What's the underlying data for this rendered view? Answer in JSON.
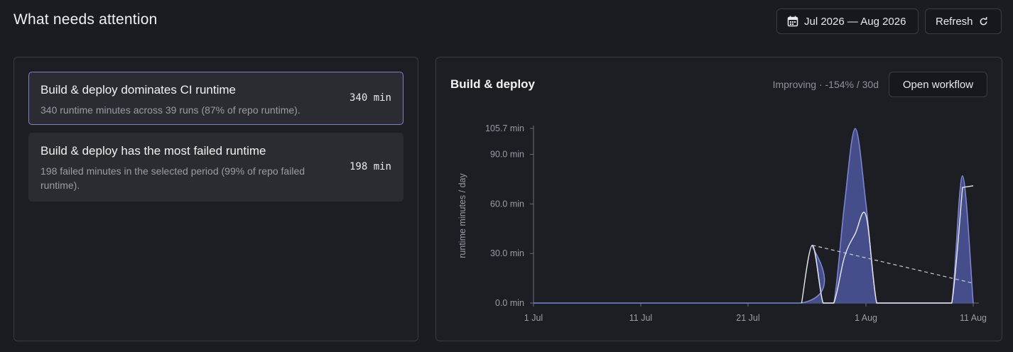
{
  "header": {
    "title": "What needs attention",
    "date_range": "Jul 2026 — Aug 2026",
    "refresh_label": "Refresh"
  },
  "insights": [
    {
      "title": "Build & deploy dominates CI runtime",
      "description": "340 runtime minutes across 39 runs (87% of repo runtime).",
      "metric": "340 min",
      "selected": true
    },
    {
      "title": "Build & deploy has the most failed runtime",
      "description": "198 failed minutes in the selected period (99% of repo failed runtime).",
      "metric": "198 min",
      "selected": false
    }
  ],
  "chart_panel": {
    "title": "Build & deploy",
    "trend": "Improving · -154% / 30d",
    "open_label": "Open workflow"
  },
  "colors": {
    "accent_fill": "#4a5296",
    "accent_line": "#7f88d6",
    "selected_border": "#7d82c8"
  },
  "chart_data": {
    "type": "area",
    "ylabel": "runtime minutes / day",
    "y_ticks": [
      "0.0 min",
      "30.0 min",
      "60.0 min",
      "90.0 min",
      "105.7 min"
    ],
    "y_tick_values": [
      0,
      30,
      60,
      90,
      105.7
    ],
    "ylim": [
      0,
      105.7
    ],
    "x_ticks": [
      "1 Jul",
      "11 Jul",
      "21 Jul",
      "1 Aug",
      "11 Aug"
    ],
    "x_tick_days": [
      0,
      10,
      20,
      31,
      41
    ],
    "xlim": [
      0,
      41
    ],
    "series": [
      {
        "kind": "daily",
        "x": [
          25,
          26,
          27,
          28,
          29,
          30,
          31,
          32,
          33,
          34,
          35,
          36,
          37,
          38,
          39,
          40,
          41
        ],
        "values": [
          0,
          35,
          0,
          0,
          60,
          105.7,
          60,
          0,
          0,
          0,
          0,
          0,
          0,
          0,
          0,
          77,
          0
        ]
      },
      {
        "kind": "rolling",
        "x": [
          25,
          26,
          27,
          28,
          29,
          30,
          31,
          32,
          33,
          34,
          35,
          36,
          37,
          38,
          39,
          40,
          41
        ],
        "values": [
          0,
          35,
          0,
          0,
          28,
          42,
          53,
          0,
          0,
          0,
          0,
          0,
          0,
          0,
          0,
          70,
          71
        ]
      },
      {
        "kind": "trend",
        "x": [
          26,
          41
        ],
        "values": [
          35,
          12
        ]
      }
    ]
  }
}
